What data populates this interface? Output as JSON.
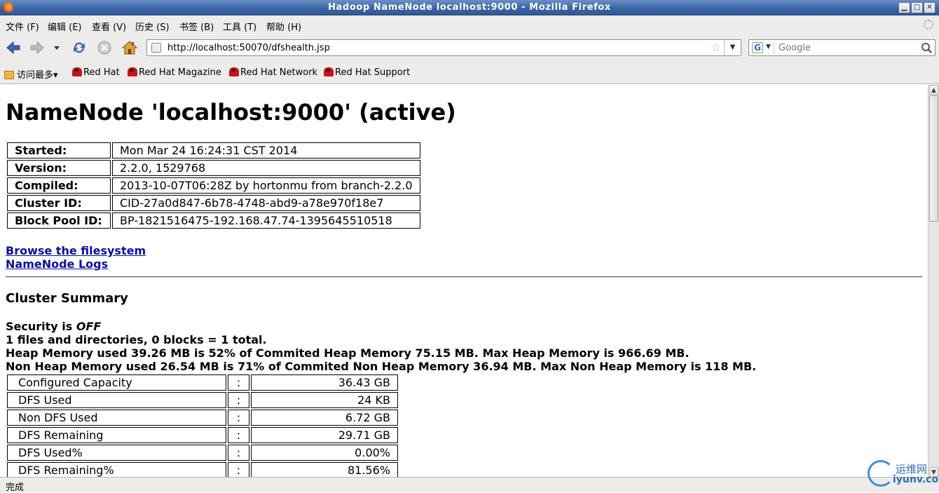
{
  "window": {
    "title": "Hadoop NameNode localhost:9000 - Mozilla Firefox",
    "icon": "firefox-icon",
    "controls": [
      "minimize",
      "maximize",
      "close"
    ]
  },
  "menu": {
    "items": [
      "文件 (F)",
      "编辑 (E)",
      "查看 (V)",
      "历史 (S)",
      "书签 (B)",
      "工具 (T)",
      "帮助 (H)"
    ]
  },
  "navbar": {
    "url": "http://localhost:50070/dfshealth.jsp",
    "search_placeholder": "Google"
  },
  "bookmarks": {
    "most_visited": "访问最多",
    "items": [
      "Red Hat",
      "Red Hat Magazine",
      "Red Hat Network",
      "Red Hat Support"
    ]
  },
  "page": {
    "title": "NameNode 'localhost:9000' (active)",
    "info": [
      {
        "label": "Started:",
        "value": "Mon Mar 24 16:24:31 CST 2014"
      },
      {
        "label": "Version:",
        "value": "2.2.0, 1529768"
      },
      {
        "label": "Compiled:",
        "value": "2013-10-07T06:28Z by hortonmu from branch-2.2.0"
      },
      {
        "label": "Cluster ID:",
        "value": "CID-27a0d847-6b78-4748-abd9-a78e970f18e7"
      },
      {
        "label": "Block Pool ID:",
        "value": "BP-1821516475-192.168.47.74-1395645510518"
      }
    ],
    "links": [
      "Browse the filesystem",
      "NameNode Logs"
    ],
    "section_title": "Cluster Summary",
    "security_prefix": "Security is ",
    "security_state": "OFF",
    "summary_lines": [
      "1 files and directories, 0 blocks = 1 total.",
      "Heap Memory used 39.26 MB is 52% of Commited Heap Memory 75.15 MB. Max Heap Memory is 966.69 MB.",
      "Non Heap Memory used 26.54 MB is 71% of Commited Non Heap Memory 36.94 MB. Max Non Heap Memory is 118 MB."
    ],
    "stats_separator": ":",
    "stats": [
      {
        "label": "Configured Capacity",
        "value": "36.43 GB"
      },
      {
        "label": "DFS Used",
        "value": "24 KB"
      },
      {
        "label": "Non DFS Used",
        "value": "6.72 GB"
      },
      {
        "label": "DFS Remaining",
        "value": "29.71 GB"
      },
      {
        "label": "DFS Used%",
        "value": "0.00%"
      },
      {
        "label": "DFS Remaining%",
        "value": "81.56%"
      }
    ]
  },
  "status": {
    "text": "完成"
  },
  "watermark": {
    "cn": "运维网",
    "en": "iyunv.com"
  }
}
